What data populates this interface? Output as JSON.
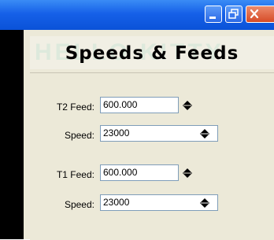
{
  "window": {
    "title_bar_color": "#0a52d8",
    "buttons": [
      "minimize-icon",
      "restore-icon",
      "close-icon"
    ]
  },
  "panel": {
    "title": "Speeds & Feeds",
    "watermark": "HELLO KITTY"
  },
  "tools": [
    {
      "feed_label": "T2 Feed:",
      "feed_value": "600.000",
      "speed_label": "Speed:",
      "speed_value": "23000"
    },
    {
      "feed_label": "T1 Feed:",
      "feed_value": "600.000",
      "speed_label": "Speed:",
      "speed_value": "23000"
    }
  ],
  "colors": {
    "accent": "#1660e8",
    "close": "#d64b27",
    "panel_bg": "#ece9d8",
    "input_border": "#7f9db9"
  }
}
